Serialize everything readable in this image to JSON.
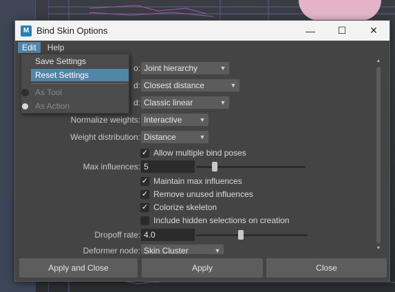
{
  "window": {
    "title": "Bind Skin Options",
    "app_icon_text": "M",
    "controls": {
      "minimize": "—",
      "maximize": "☐",
      "close": "✕"
    }
  },
  "menubar": {
    "items": [
      {
        "label": "Edit",
        "active": true
      },
      {
        "label": "Help",
        "active": false
      }
    ]
  },
  "edit_menu": {
    "items": [
      {
        "label": "Save Settings",
        "highlighted": false,
        "disabled": false
      },
      {
        "label": "Reset Settings",
        "highlighted": true,
        "disabled": false
      }
    ],
    "radio_items": [
      {
        "label": "As Tool",
        "selected": false,
        "disabled": true
      },
      {
        "label": "As Action",
        "selected": true,
        "disabled": true
      }
    ]
  },
  "options": {
    "bind_to": {
      "label_visible": "o:",
      "value": "Joint hierarchy"
    },
    "bind_method": {
      "label_visible": "d:",
      "value": "Closest distance"
    },
    "skinning_method": {
      "label_visible": "d:",
      "value": "Classic linear"
    },
    "normalize_weights": {
      "label": "Normalize weights:",
      "value": "Interactive"
    },
    "weight_distribution": {
      "label": "Weight distribution:",
      "value": "Distance"
    },
    "allow_multiple_bind_poses": {
      "label": "Allow multiple bind poses",
      "checked": true
    },
    "max_influences": {
      "label": "Max influences:",
      "value": "5",
      "slider_fraction": 0.17
    },
    "maintain_max_influences": {
      "label": "Maintain max influences",
      "checked": true
    },
    "remove_unused_influences": {
      "label": "Remove unused influences",
      "checked": true
    },
    "colorize_skeleton": {
      "label": "Colorize skeleton",
      "checked": true
    },
    "include_hidden_selections": {
      "label": "Include hidden selections on creation",
      "checked": false
    },
    "dropoff_rate": {
      "label": "Dropoff rate:",
      "value": "4.0",
      "slider_fraction": 0.4
    },
    "deformer_node": {
      "label": "Deformer node:",
      "value": "Skin Cluster"
    }
  },
  "buttons": {
    "apply_and_close": "Apply and Close",
    "apply": "Apply",
    "close": "Close"
  },
  "icons": {
    "check": "✓",
    "dropdown_arrow": "▼",
    "scroll_up": "▲",
    "scroll_down": "▼"
  },
  "colors": {
    "accent_highlight": "#5285a6",
    "window_bg": "#444444",
    "titlebar_bg": "#f3f3f3",
    "field_bg": "#2b2b2b",
    "button_bg": "#5d5d5d"
  }
}
